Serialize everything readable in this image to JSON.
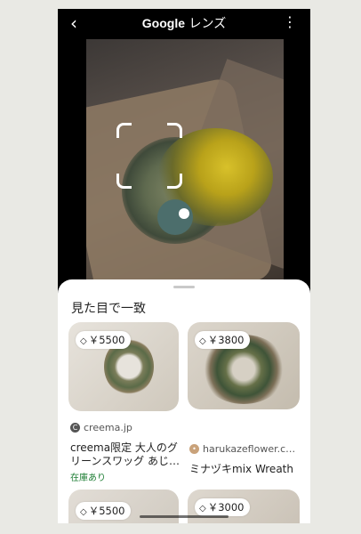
{
  "topbar": {
    "back_icon": "chevron-left-icon",
    "title_brand": "Google",
    "title_suffix": "レンズ",
    "more_icon": "more-vert-icon"
  },
  "section": {
    "title": "見た目で一致"
  },
  "results": [
    {
      "price": "￥5500",
      "source": "creema.jp",
      "name": "creema限定 大人のグリーンスワッグ あじ…",
      "stock": "在庫あり"
    },
    {
      "price": "￥3800",
      "source": "harukazeflower.c…",
      "name": "ミナヅキmix Wreath"
    },
    {
      "price": "￥5500"
    },
    {
      "price": "￥3000"
    }
  ],
  "colors": {
    "accent_green": "#1e7e34"
  }
}
